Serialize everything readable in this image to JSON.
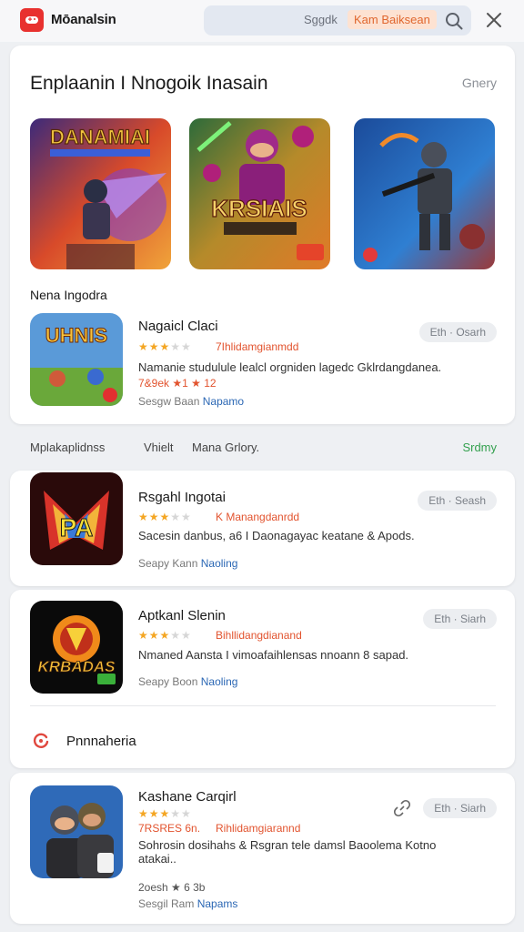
{
  "header": {
    "app_name": "Mōanalsin",
    "search_placeholder": "Sggdk",
    "search_highlight": "Kam Baiksean"
  },
  "featured": {
    "title": "Enplaanin I Nnogoik Inasain",
    "action": "Gnery",
    "banners": [
      {
        "name": "game-banner-1",
        "label": "DANAMIAI"
      },
      {
        "name": "game-banner-2",
        "label": "KRSIAIS"
      },
      {
        "name": "game-banner-3",
        "label": ""
      }
    ],
    "subsection": "Nena Ingodra"
  },
  "app1": {
    "title": "Nagaicl Claci",
    "stars": 3,
    "rating_text": "7Ihlidamgianmdd",
    "desc": "Namanie studulule lealcl orgniden lagedc Gklrdangdanea.",
    "meta": "7&9ek ★1 ★ 12",
    "dev_label": "Sesgw Baan",
    "dev_link": "Napamo",
    "button": "Eth · Osarh"
  },
  "filters": {
    "items": [
      "Mplakaplidnss",
      "Vhielt",
      "Mana Grlory."
    ],
    "action": "Srdmy"
  },
  "app2": {
    "title": "Rsgahl Ingotai",
    "stars": 3,
    "rating_text": "K Manangdanrdd",
    "desc": "Sacesin danbus, a6 I Daonagayac keatane & Apods.",
    "dev_label": "Seapy Kann",
    "dev_link": "Naoling",
    "button": "Eth · Seash"
  },
  "app3": {
    "title": "Aptkanl Slenin",
    "stars": 3,
    "rating_text": "Bihllidangdianand",
    "desc": "Nmaned Aansta I vimoafaihlensas nnoann 8 sapad.",
    "dev_label": "Seapy Boon",
    "dev_link": "Naoling",
    "button": "Eth · Siarh"
  },
  "section_footer": "Pnnnaheria",
  "app4": {
    "title": "Kashane Carqirl",
    "stars": 3,
    "rating_text": "Rihlidamgiarannd",
    "rating_prefix": "7RSRES 6n.",
    "desc": "Sohrosin dosihahs & Rsgran tele damsl Baoolema Kotno atakai..",
    "meta": "2oesh ★ 6 3b",
    "dev_label": "Sesgil Ram",
    "dev_link": "Napams",
    "button": "Eth · Siarh"
  },
  "colors": {
    "accent": "#e8312f",
    "star": "#f4a623",
    "link": "#2b67b4",
    "green": "#33a04e"
  }
}
